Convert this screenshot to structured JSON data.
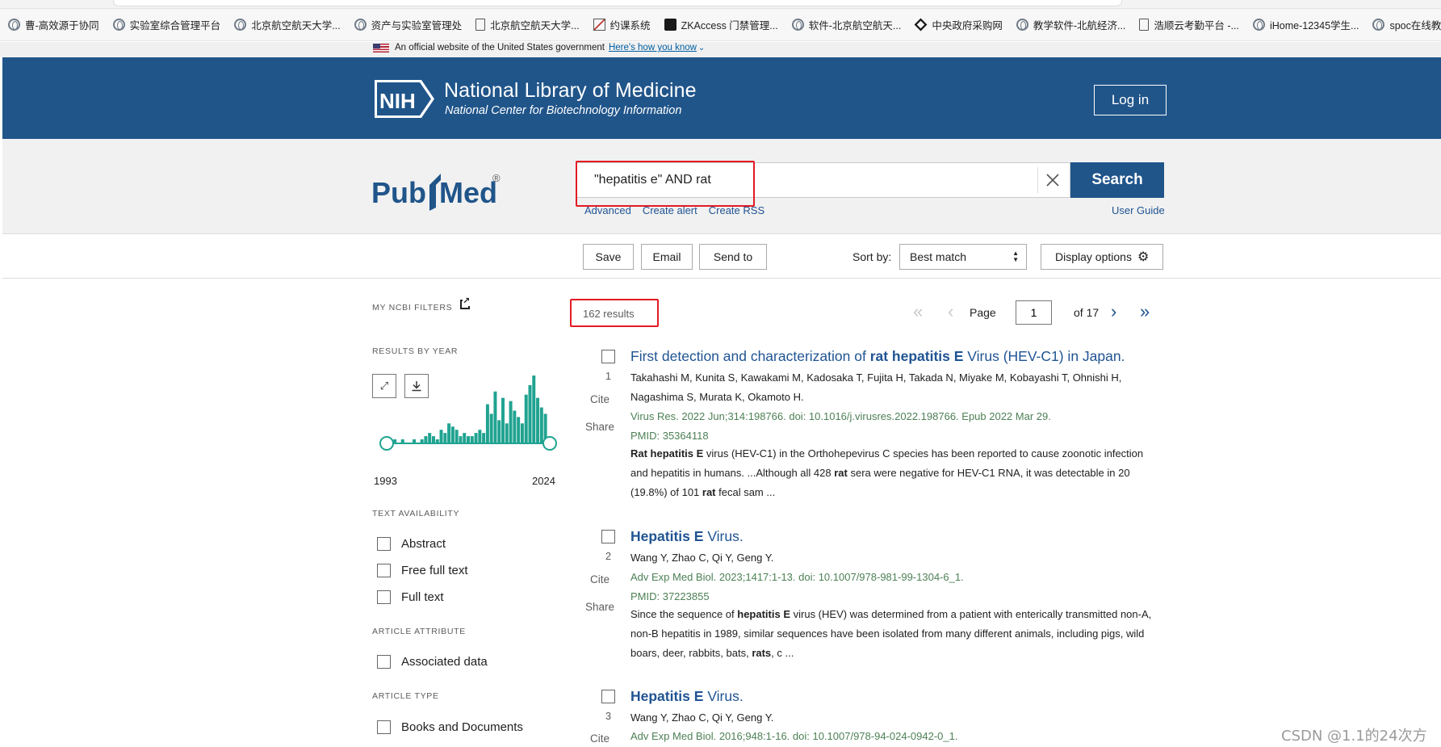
{
  "browser": {
    "bookmarks": [
      {
        "label": "曹-高效源于协同",
        "icon": "globe-icon"
      },
      {
        "label": "实验室综合管理平台",
        "icon": "globe-icon"
      },
      {
        "label": "北京航空航天大学...",
        "icon": "globe-icon"
      },
      {
        "label": "资产与实验室管理处",
        "icon": "globe-icon"
      },
      {
        "label": "北京航空航天大学...",
        "icon": "document-icon"
      },
      {
        "label": "约课系统",
        "icon": "chart-icon"
      },
      {
        "label": "ZKAccess 门禁管理...",
        "icon": "zk-icon"
      },
      {
        "label": "软件-北京航空航天...",
        "icon": "globe-icon"
      },
      {
        "label": "中央政府采购网",
        "icon": "diamond-icon"
      },
      {
        "label": "教学软件-北航经济...",
        "icon": "globe-icon"
      },
      {
        "label": "浩顺云考勤平台 -...",
        "icon": "document-icon"
      },
      {
        "label": "iHome-12345学生...",
        "icon": "globe-icon"
      },
      {
        "label": "spoc在线教学平",
        "icon": "globe-icon"
      }
    ]
  },
  "gov_banner": {
    "text": "An official website of the United States government",
    "link": "Here's how you know"
  },
  "header": {
    "logo_text": "NIH",
    "title": "National Library of Medicine",
    "subtitle": "National Center for Biotechnology Information",
    "login_label": "Log in"
  },
  "search": {
    "logo_pub": "Pub",
    "logo_med": "Med",
    "logo_reg": "®",
    "query": "\"hepatitis e\" AND rat",
    "button_label": "Search",
    "links": [
      "Advanced",
      "Create alert",
      "Create RSS"
    ],
    "user_guide": "User Guide"
  },
  "actions": {
    "save": "Save",
    "email": "Email",
    "send_to": "Send to",
    "sort_label": "Sort by:",
    "sort_value": "Best match",
    "display_options": "Display options"
  },
  "sidebar": {
    "my_filters": "MY NCBI FILTERS",
    "results_by_year": "RESULTS BY YEAR",
    "year_start": "1993",
    "year_end": "2024",
    "year_counts": [
      0,
      1,
      0,
      1,
      0,
      0,
      1,
      0,
      1,
      2,
      3,
      2,
      1,
      4,
      3,
      6,
      5,
      4,
      2,
      3,
      2,
      2,
      3,
      4,
      3,
      12,
      9,
      16,
      7,
      14,
      6,
      13,
      10,
      8,
      6,
      15,
      18,
      21,
      14,
      11,
      9
    ],
    "text_availability": "TEXT AVAILABILITY",
    "text_filters": [
      "Abstract",
      "Free full text",
      "Full text"
    ],
    "article_attribute": "ARTICLE ATTRIBUTE",
    "attribute_filters": [
      "Associated data"
    ],
    "article_type": "ARTICLE TYPE",
    "type_filters": [
      "Books and Documents"
    ]
  },
  "results": {
    "count": "162 results",
    "page_label": "Page",
    "page_current": "1",
    "page_total": "of 17"
  },
  "articles": [
    {
      "num": "1",
      "title_pre": "First detection and characterization of ",
      "title_bold": "rat hepatitis E",
      "title_post": " Virus (HEV-C1) in Japan.",
      "authors": "Takahashi M, Kunita S, Kawakami M, Kadosaka T, Fujita H, Takada N, Miyake M, Kobayashi T, Ohnishi H,",
      "authors2": "Nagashima S, Murata K, Okamoto H.",
      "journal": "Virus Res. 2022 Jun;314:198766. doi: 10.1016/j.virusres.2022.198766. Epub 2022 Mar 29.",
      "pmid": "PMID: 35364118",
      "snippet_1": "Rat hepatitis E",
      "snippet_2": " virus (HEV-C1) in the Orthohepevirus C species has been reported to cause zoonotic infection and hepatitis in humans. ...Although all 428 ",
      "snippet_3": "rat",
      "snippet_4": " sera were negative for HEV-C1 RNA, it was detectable in 20 (19.8%) of 101 ",
      "snippet_5": "rat",
      "snippet_6": " fecal sam ...",
      "cite": "Cite",
      "share": "Share"
    },
    {
      "num": "2",
      "title_bold": "Hepatitis E",
      "title_post": " Virus.",
      "authors": "Wang Y, Zhao C, Qi Y, Geng Y.",
      "journal": "Adv Exp Med Biol. 2023;1417:1-13. doi: 10.1007/978-981-99-1304-6_1.",
      "pmid": "PMID: 37223855",
      "snippet_1": "Since the sequence of ",
      "snippet_2": "hepatitis E",
      "snippet_3": " virus (HEV) was determined from a patient with enterically transmitted non-A, non-B hepatitis in 1989, similar sequences have been isolated from many different animals, including pigs, wild boars, deer, rabbits, bats, ",
      "snippet_4": "rats",
      "snippet_5": ", c ...",
      "cite": "Cite",
      "share": "Share"
    },
    {
      "num": "3",
      "title_bold": "Hepatitis E",
      "title_post": " Virus.",
      "authors": "Wang Y, Zhao C, Qi Y, Geng Y.",
      "journal": "Adv Exp Med Biol. 2016;948:1-16. doi: 10.1007/978-94-024-0942-0_1.",
      "cite": "Cite"
    }
  ],
  "watermark": "CSDN @1.1的24次方",
  "colors": {
    "header_bg": "#20558a",
    "link": "#205493",
    "journal": "#4d8055",
    "highlight_box": "#e21b24",
    "histogram": "#20a391"
  }
}
